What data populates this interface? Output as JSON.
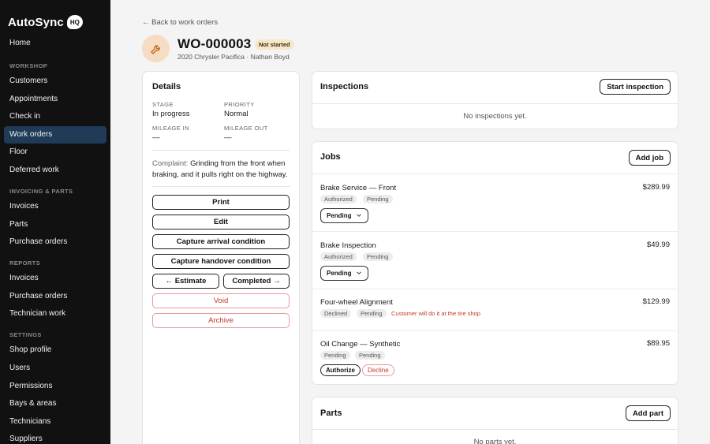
{
  "brand": {
    "name": "AutoSync",
    "badge": "HQ"
  },
  "nav": {
    "home": "Home",
    "workshop_label": "WORKSHOP",
    "workshop": [
      "Customers",
      "Appointments",
      "Check in",
      "Work orders",
      "Floor",
      "Deferred work"
    ],
    "invoicing_label": "INVOICING & PARTS",
    "invoicing": [
      "Invoices",
      "Parts",
      "Purchase orders"
    ],
    "reports_label": "REPORTS",
    "reports": [
      "Invoices",
      "Purchase orders",
      "Technician work"
    ],
    "settings_label": "SETTINGS",
    "settings": [
      "Shop profile",
      "Users",
      "Permissions",
      "Bays & areas",
      "Technicians",
      "Suppliers"
    ],
    "active": "Work orders"
  },
  "header": {
    "back_link": "← Back to work orders",
    "title": "WO-000003",
    "status": "Not started",
    "subtitle": "2020 Chrysler Pacifica · Nathan Boyd",
    "avatar_icon": "wrench-icon"
  },
  "details": {
    "title": "Details",
    "stage_label": "STAGE",
    "stage": "In progress",
    "priority_label": "PRIORITY",
    "priority": "Normal",
    "mileage_in_label": "MILEAGE IN",
    "mileage_in": "—",
    "mileage_out_label": "MILEAGE OUT",
    "mileage_out": "—",
    "complaint_label": "Complaint:",
    "complaint": "Grinding from the front when braking, and it pulls right on the highway.",
    "buttons": {
      "print": "Print",
      "edit": "Edit",
      "arrival": "Capture arrival condition",
      "handover": "Capture handover condition",
      "estimate": "← Estimate",
      "completed": "Completed →",
      "void": "Void",
      "archive": "Archive"
    }
  },
  "inspections": {
    "title": "Inspections",
    "button": "Start inspection",
    "empty": "No inspections yet."
  },
  "jobs": {
    "title": "Jobs",
    "button": "Add job",
    "items": [
      {
        "name": "Brake Service — Front",
        "price": "$289.99",
        "tags": [
          "Authorized",
          "Pending"
        ],
        "select": "Pending"
      },
      {
        "name": "Brake Inspection",
        "price": "$49.99",
        "tags": [
          "Authorized",
          "Pending"
        ],
        "select": "Pending"
      },
      {
        "name": "Four-wheel Alignment",
        "price": "$129.99",
        "tags": [
          "Declined",
          "Pending"
        ],
        "note": "Customer will do it at the tire shop"
      },
      {
        "name": "Oil Change — Synthetic",
        "price": "$89.95",
        "tags": [
          "Pending",
          "Pending"
        ],
        "actions": [
          "Authorize",
          "Decline"
        ]
      }
    ]
  },
  "parts": {
    "title": "Parts",
    "button": "Add part",
    "empty": "No parts yet."
  },
  "colors": {
    "sidebar_bg": "#111111",
    "active_nav": "#1f3b57",
    "status_badge": "#f6e7c8",
    "avatar_bg": "#f6dcc3",
    "danger": "#c0392b"
  }
}
